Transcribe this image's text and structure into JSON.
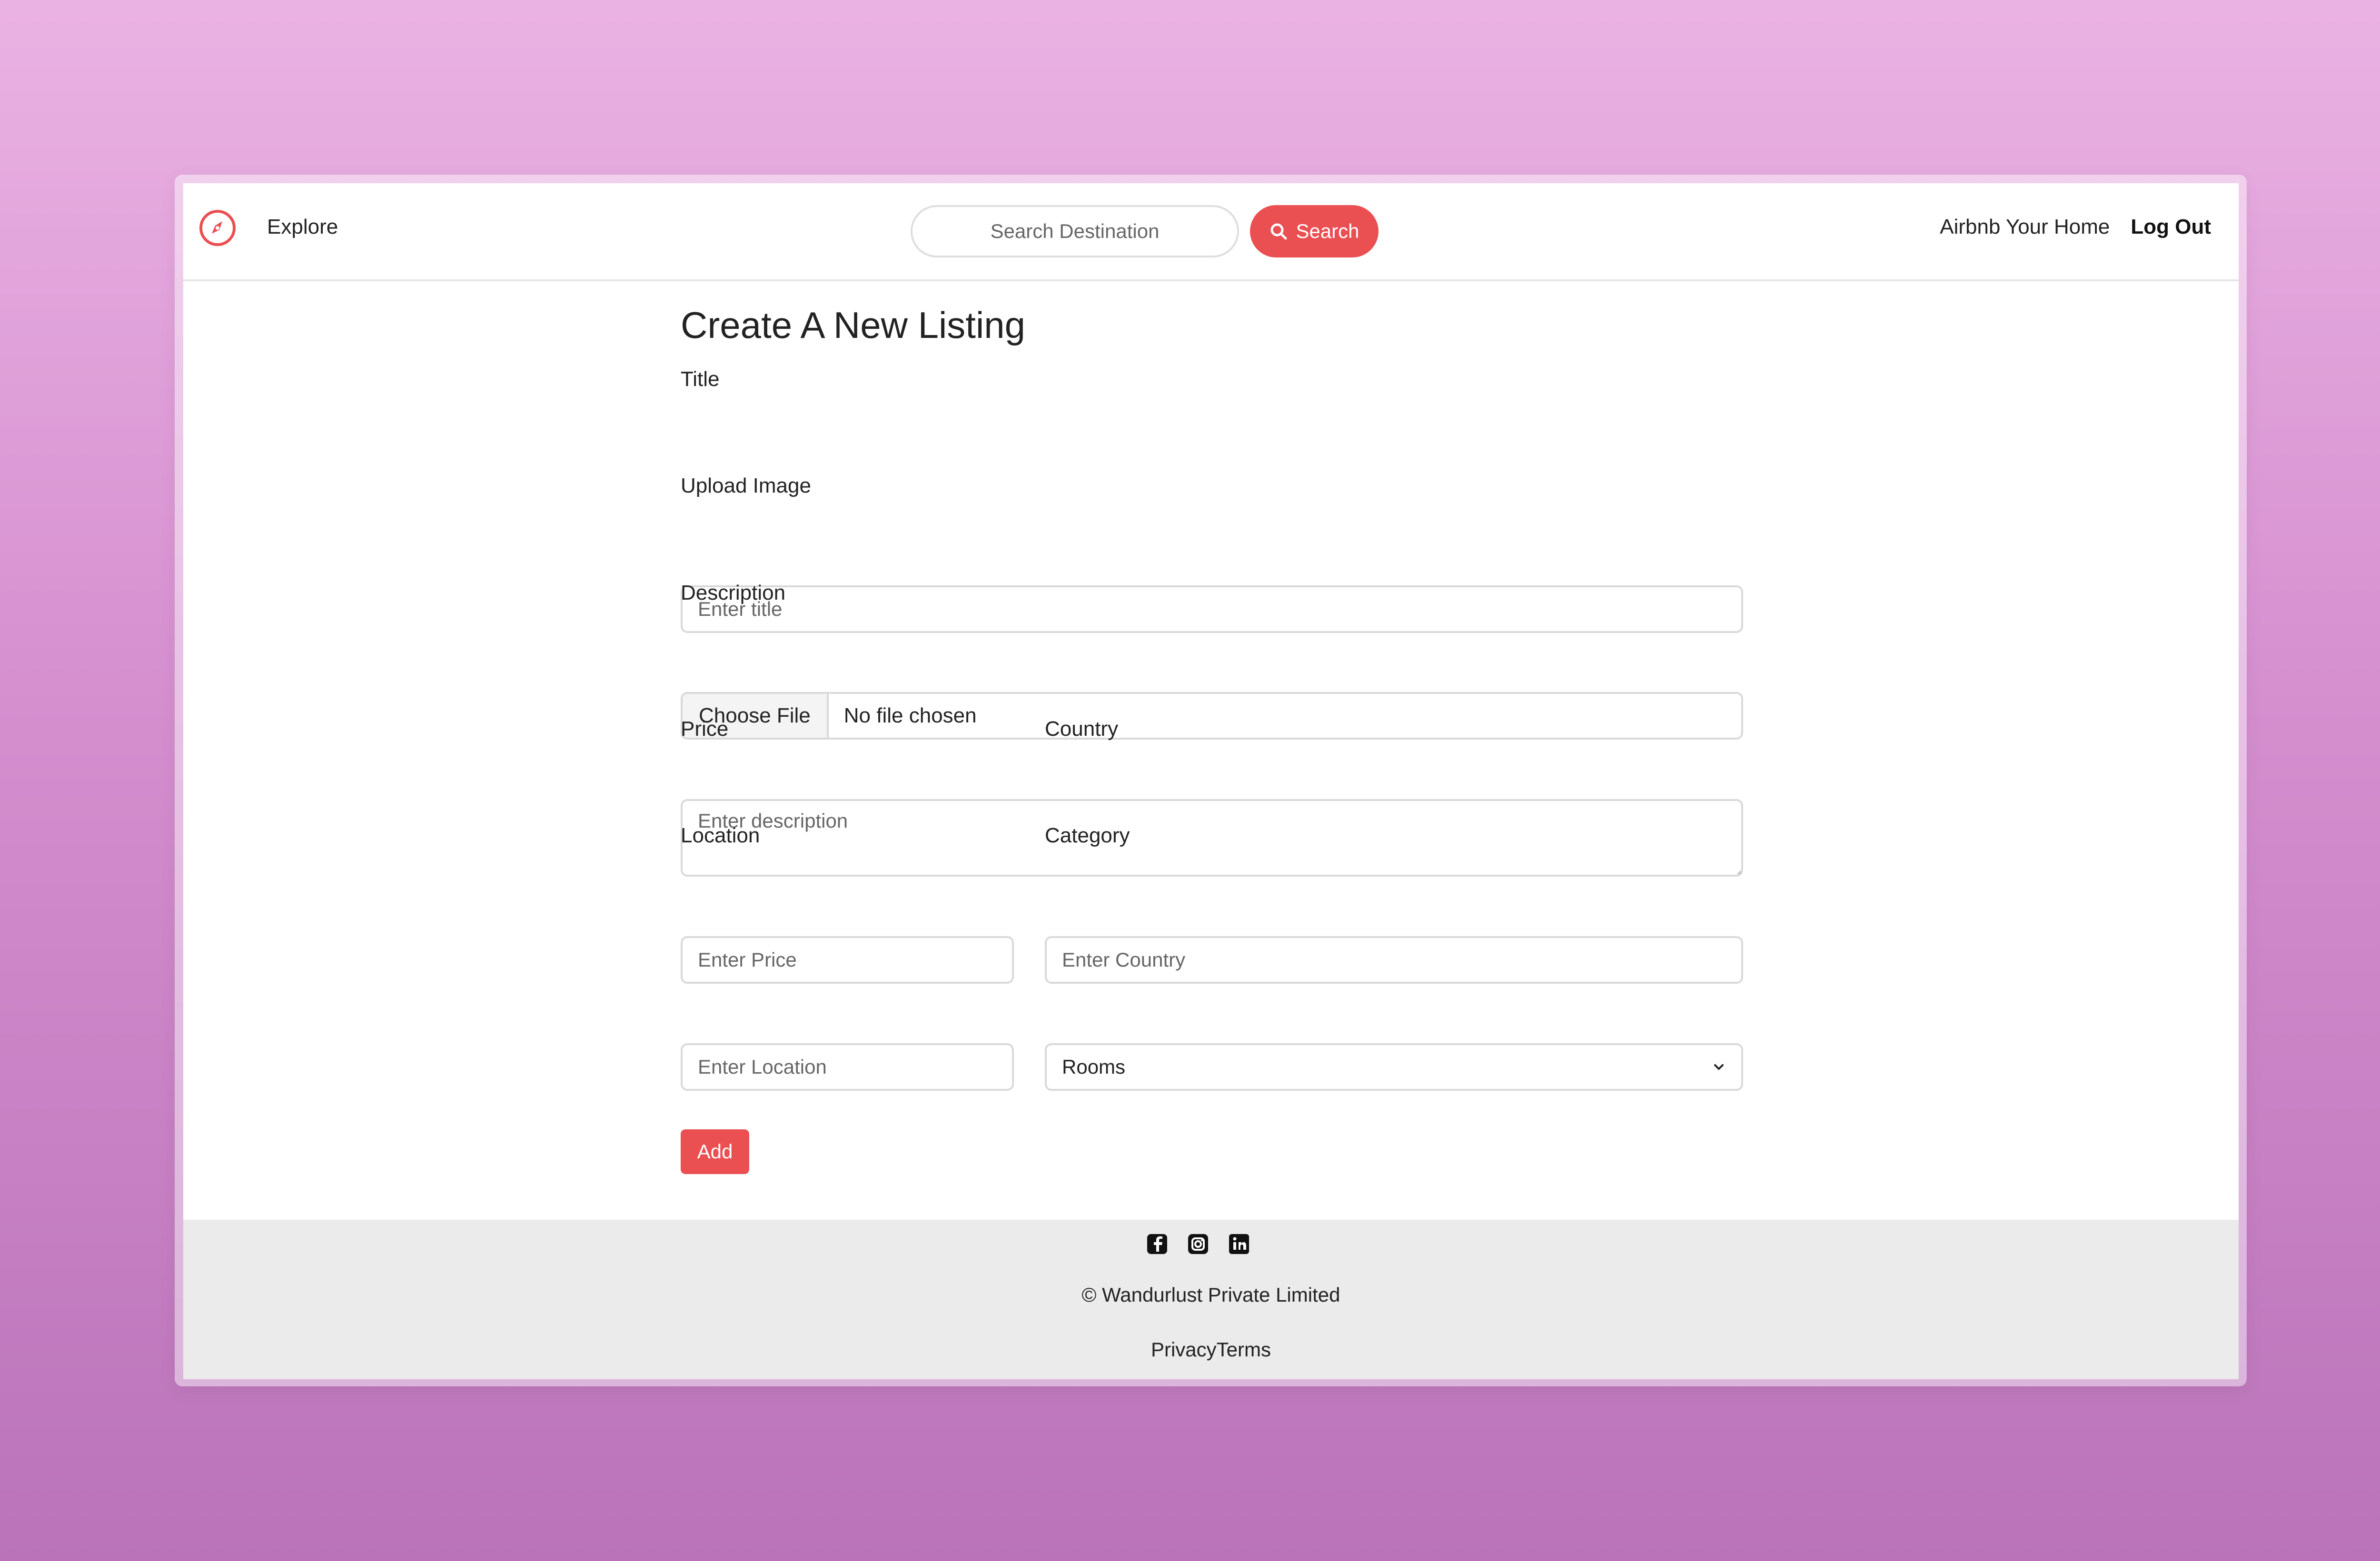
{
  "brand": {
    "accent_color": "#ea4f52",
    "logo_icon": "compass-icon"
  },
  "navbar": {
    "explore_label": "Explore",
    "search_placeholder": "Search Destination",
    "search_button_label": "Search",
    "search_icon": "search-icon",
    "airbnb_home_label": "Airbnb Your Home",
    "logout_label": "Log Out"
  },
  "form": {
    "title": "Create A New Listing",
    "fields": {
      "title": {
        "label": "Title",
        "placeholder": "Enter title"
      },
      "image": {
        "label": "Upload Image",
        "button_label": "Choose File",
        "status": "No file chosen"
      },
      "description": {
        "label": "Description",
        "placeholder": "Enter description"
      },
      "price": {
        "label": "Price",
        "placeholder": "Enter Price"
      },
      "country": {
        "label": "Country",
        "placeholder": "Enter Country"
      },
      "location": {
        "label": "Location",
        "placeholder": "Enter Location"
      },
      "category": {
        "label": "Category",
        "selected_value": "Rooms"
      }
    },
    "submit_label": "Add"
  },
  "footer": {
    "social_icons": [
      "facebook-icon",
      "instagram-icon",
      "linkedin-icon"
    ],
    "copyright": "© Wandurlust Private Limited",
    "privacy_label": "Privacy",
    "terms_label": "Terms"
  }
}
